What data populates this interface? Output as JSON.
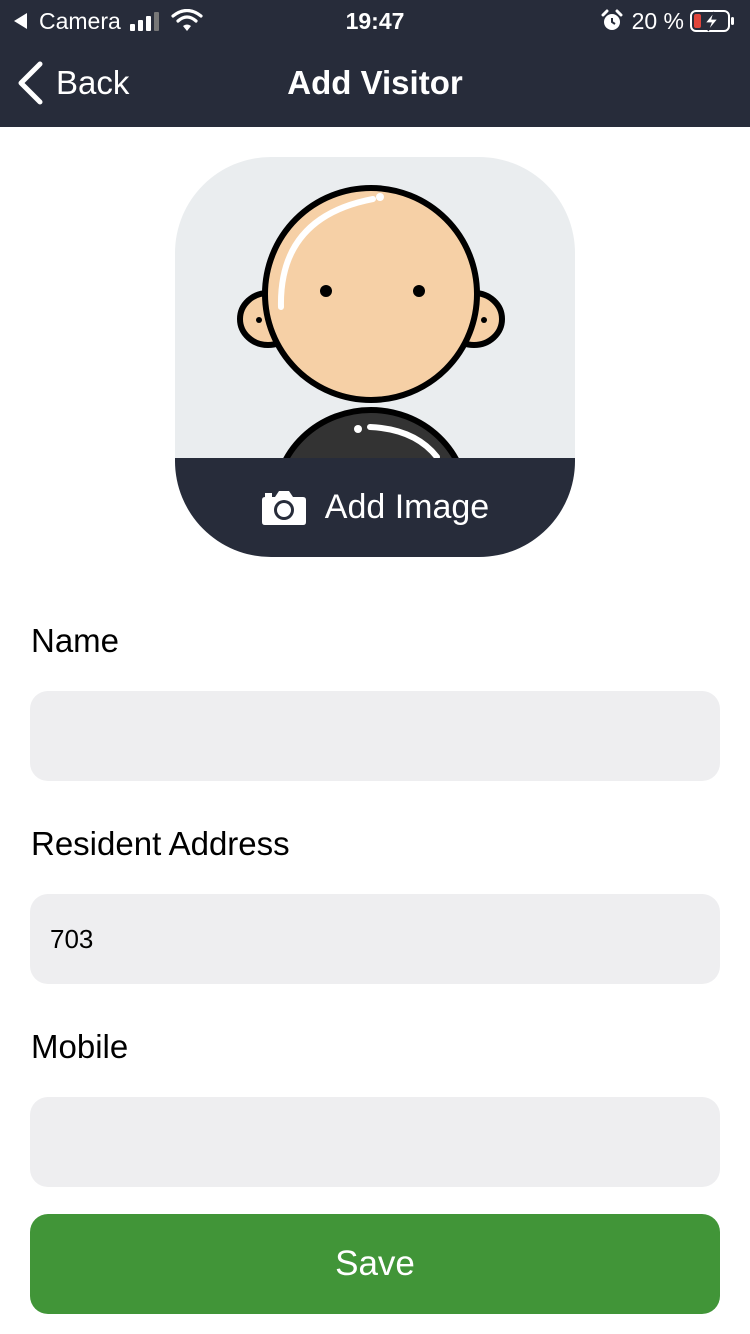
{
  "status_bar": {
    "carrier": "Camera",
    "time": "19:47",
    "battery_percent": "20 %"
  },
  "nav": {
    "back_label": "Back",
    "title": "Add Visitor"
  },
  "avatar": {
    "add_image_label": "Add Image"
  },
  "form": {
    "name": {
      "label": "Name",
      "value": ""
    },
    "address": {
      "label": "Resident Address",
      "value": "703"
    },
    "mobile": {
      "label": "Mobile",
      "value": ""
    }
  },
  "actions": {
    "save_label": "Save"
  },
  "colors": {
    "header_bg": "#272c3a",
    "save_green": "#419538",
    "field_bg": "#eeeef0",
    "avatar_bg": "#eaedef"
  }
}
